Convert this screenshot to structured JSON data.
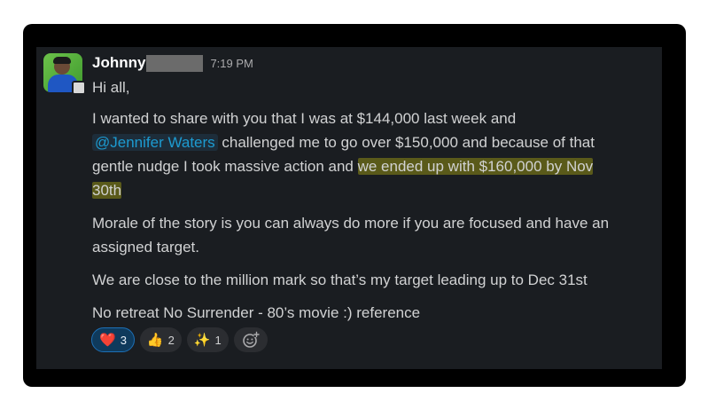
{
  "message": {
    "author": "Johnny",
    "time": "7:19 PM",
    "lines": {
      "greeting": "Hi all,",
      "p1_line1": "I wanted to share with you that I was at $144,000 last week and",
      "mention": "@Jennifer Waters",
      "p1_line2_rest": " challenged me to go over $150,000 and because of that",
      "p1_line3_plain": "gentle nudge I took massive action and ",
      "p1_line3_highlight": "we ended up with $160,000 by Nov",
      "p1_line4_highlight": "30th",
      "p2_line1": "Morale of the story is you can always do more if you are focused and have an",
      "p2_line2": "assigned target.",
      "p3": "We are close to the million mark so that’s my target leading up to Dec 31st",
      "p4": "No retreat No Surrender - 80’s movie :) reference"
    }
  },
  "reactions": [
    {
      "emoji": "❤️",
      "icon": "heart-icon",
      "count": "3",
      "active": true
    },
    {
      "emoji": "👍",
      "icon": "thumbs-up-icon",
      "count": "2",
      "active": false
    },
    {
      "emoji": "✨",
      "icon": "sparkles-icon",
      "count": "1",
      "active": false
    }
  ],
  "colors": {
    "panel_bg": "#1a1d21",
    "mention": "#1d9bd1",
    "highlight": "#5a5a1a",
    "active_reaction": "#0f3a5c"
  }
}
